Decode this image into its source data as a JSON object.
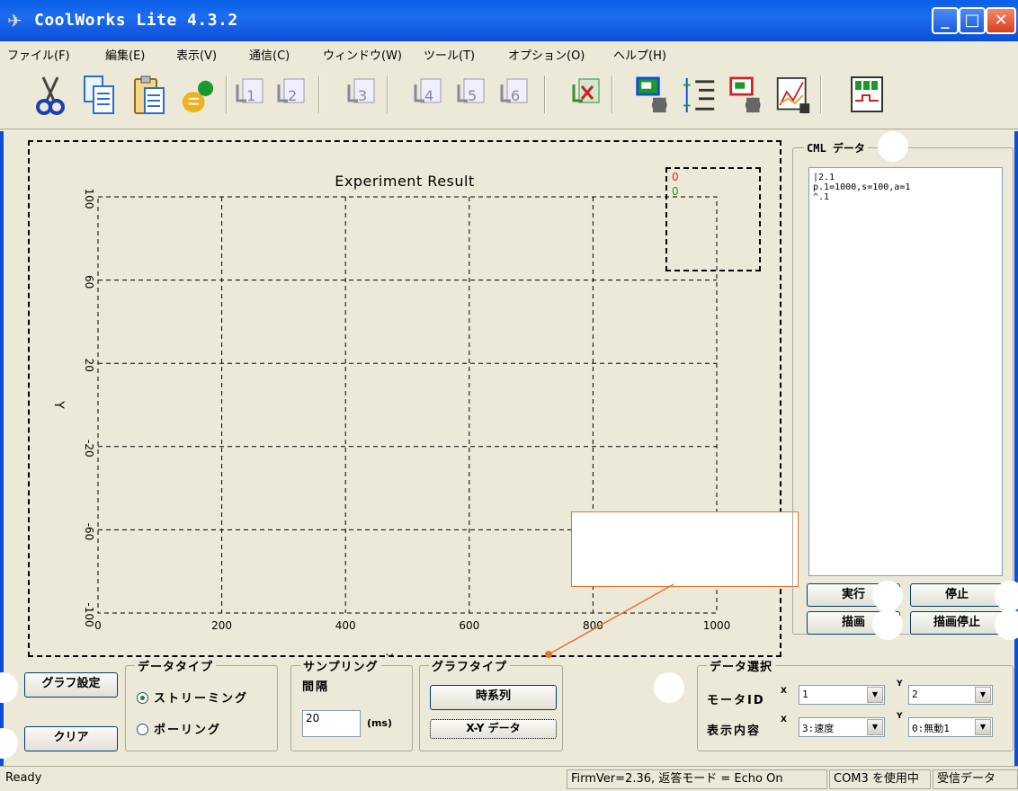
{
  "window": {
    "title": "CoolWorks Lite 4.3.2"
  },
  "menu": [
    "ファイル(F)",
    "編集(E)",
    "表示(V)",
    "通信(C)",
    "ウィンドウ(W)",
    "ツール(T)",
    "オプション(O)",
    "ヘルプ(H)"
  ],
  "toolbar": {
    "tools": [
      "cut-icon",
      "copy-icon",
      "paste-icon",
      "new-user-icon",
      "script-1-icon",
      "script-2-icon",
      "script-3-icon",
      "script-4-icon",
      "script-5-icon",
      "script-6-icon",
      "script-x-icon",
      "motor-monitor-icon",
      "list-indent-icon",
      "motor-config-icon",
      "graph-window-icon",
      "panel-view-icon"
    ],
    "script_numbers": [
      "1",
      "2",
      "3",
      "4",
      "5",
      "6"
    ]
  },
  "chart_data": {
    "type": "line",
    "title": "Experiment Result",
    "xlabel": "X",
    "ylabel": "Y",
    "x_ticks": [
      "0",
      "200",
      "400",
      "600",
      "800",
      "1000"
    ],
    "y_ticks": [
      "100",
      "60",
      "20",
      "-20",
      "-60",
      "-100"
    ],
    "xlim": [
      0,
      1000
    ],
    "ylim": [
      -100,
      100
    ],
    "grid": true,
    "legend_position": "top-right",
    "series": [
      {
        "marker": "0",
        "color": "#e02020",
        "values": []
      },
      {
        "marker": "0",
        "color": "#18a018",
        "values": []
      }
    ]
  },
  "cml": {
    "legend": "CML データ",
    "text": "|2.1\np.1=1000,s=100,a=1\n^.1",
    "buttons": {
      "run": "実行",
      "stop": "停止",
      "draw": "描画",
      "draw_stop": "描画停止"
    }
  },
  "controls": {
    "graph_settings": "グラフ設定",
    "clear": "クリア",
    "data_type": {
      "legend": "データタイプ",
      "streaming": "ストリーミング",
      "polling": "ポーリング",
      "selected": "streaming"
    },
    "sampling": {
      "legend": "サンプリング",
      "interval_label": "間隔",
      "value": "20",
      "unit": "(ms)"
    },
    "graph_type": {
      "legend": "グラフタイプ",
      "time_series": "時系列",
      "xy": "X-Y データ"
    },
    "data_select": {
      "legend": "データ選択",
      "motor_id_label": "モータID",
      "content_label": "表示内容",
      "x_label": "X",
      "y_label": "Y",
      "motor_x": "1",
      "motor_y": "2",
      "content_x": "3:速度",
      "content_y": "0:無動1"
    }
  },
  "status": {
    "left": "Ready",
    "firmware": "FirmVer=2.36, 返答モード = Echo On",
    "port": "COM3 を使用中",
    "recv": "受信データ"
  },
  "colors": {
    "title_bar": "#0b4fd6",
    "callout": "#e8742a",
    "series1": "#e02020",
    "series2": "#18a018"
  }
}
